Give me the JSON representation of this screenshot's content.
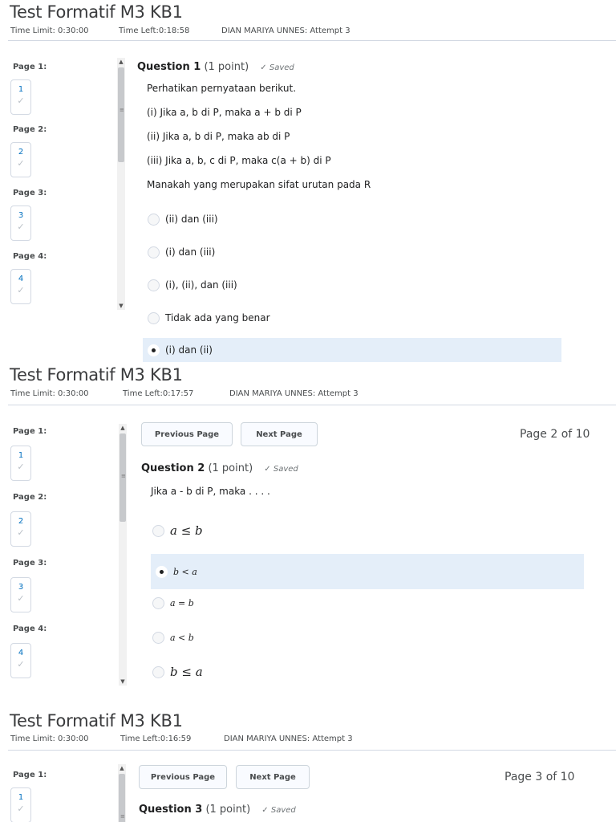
{
  "screens": [
    {
      "title": "Test Formatif M3 KB1",
      "time_limit": "Time Limit: 0:30:00",
      "time_left": "Time Left:0:18:58",
      "attempt": "DIAN MARIYA UNNES: Attempt 3",
      "pages": [
        {
          "label": "Page 1:",
          "number": "1"
        },
        {
          "label": "Page 2:",
          "number": "2"
        },
        {
          "label": "Page 3:",
          "number": "3"
        },
        {
          "label": "Page 4:",
          "number": "4"
        }
      ],
      "question": {
        "label": "Question 1",
        "points": "(1 point)",
        "status": "Saved"
      },
      "prompt_lines": [
        "Perhatikan pernyataan berikut.",
        "(i) Jika a, b di P, maka a + b di P",
        "(ii) Jika a, b di P, maka ab di P",
        "(iii) Jika a, b, c di P, maka c(a + b) di P",
        "Manakah yang merupakan sifat urutan pada R"
      ],
      "options": [
        "(ii) dan (iii)",
        "(i) dan (iii)",
        "(i), (ii), dan (iii)",
        "Tidak ada yang benar",
        "(i) dan (ii)"
      ],
      "selected_index": 4
    },
    {
      "title": "Test Formatif M3 KB1",
      "time_limit": "Time Limit: 0:30:00",
      "time_left": "Time Left:0:17:57",
      "attempt": "DIAN MARIYA UNNES: Attempt 3",
      "pages": [
        {
          "label": "Page 1:",
          "number": "1"
        },
        {
          "label": "Page 2:",
          "number": "2"
        },
        {
          "label": "Page 3:",
          "number": "3"
        },
        {
          "label": "Page 4:",
          "number": "4"
        }
      ],
      "prev_label": "Previous Page",
      "next_label": "Next Page",
      "page_of": "Page 2 of 10",
      "question": {
        "label": "Question 2",
        "points": "(1 point)",
        "status": "Saved"
      },
      "prompt": "Jika a - b di P, maka . . . .",
      "options": [
        "a ≤ b",
        "b < a",
        "a = b",
        "a < b",
        "b ≤ a"
      ],
      "selected_index": 1
    },
    {
      "title": "Test Formatif M3 KB1",
      "time_limit": "Time Limit: 0:30:00",
      "time_left": "Time Left:0:16:59",
      "attempt": "DIAN MARIYA UNNES: Attempt 3",
      "pages": [
        {
          "label": "Page 1:",
          "number": "1"
        }
      ],
      "prev_label": "Previous Page",
      "next_label": "Next Page",
      "page_of": "Page 3 of 10",
      "question": {
        "label": "Question 3",
        "points": "(1 point)",
        "status": "Saved"
      }
    }
  ],
  "icons": {
    "check": "check-icon",
    "scroll_up": "arrow-up-icon",
    "scroll_down": "arrow-down-icon"
  }
}
